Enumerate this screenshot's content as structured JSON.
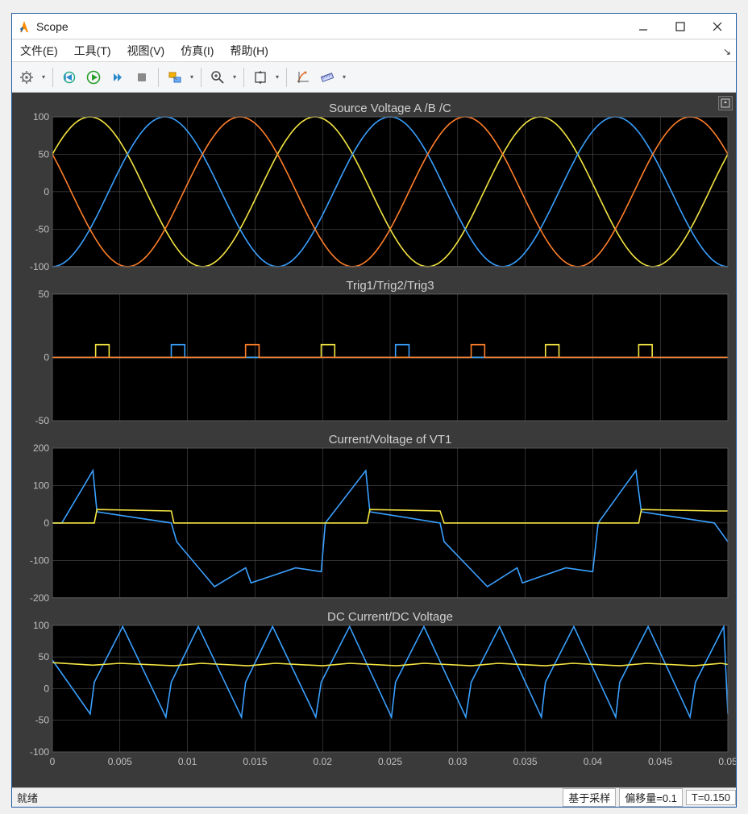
{
  "window": {
    "title": "Scope"
  },
  "menubar": {
    "file": "文件(E)",
    "tools": "工具(T)",
    "view": "视图(V)",
    "simulation": "仿真(I)",
    "help": "帮助(H)"
  },
  "toolbar": {
    "config": "config",
    "step_back": "step-back",
    "run": "run",
    "step_fwd": "step-forward",
    "stop": "stop",
    "highlight": "highlight",
    "zoom": "zoom",
    "fit": "fit-to-view",
    "cursor": "cursor-measure",
    "ruler": "ruler"
  },
  "statusbar": {
    "ready": "就绪",
    "sampled": "基于采样",
    "offset": "偏移量=0.1",
    "time": "T=0.150"
  },
  "chart_data": [
    {
      "type": "line",
      "title": "Source Voltage A /B /C",
      "xlim": [
        0,
        0.05
      ],
      "ylim": [
        -100,
        100
      ],
      "yticks": [
        -100,
        -50,
        0,
        50,
        100
      ],
      "xticks": [
        0,
        0.005,
        0.01,
        0.015,
        0.02,
        0.025,
        0.03,
        0.035,
        0.04,
        0.045,
        0.05
      ],
      "series": [
        {
          "name": "A",
          "color": "#f5e542",
          "formula": "100*sin(2*pi*60*t + 0.5236)"
        },
        {
          "name": "B",
          "color": "#3aa0ff",
          "formula": "100*sin(2*pi*60*t + 0.5236 - 2.0944)"
        },
        {
          "name": "C",
          "color": "#ff7f2a",
          "formula": "100*sin(2*pi*60*t + 0.5236 + 2.0944)"
        }
      ]
    },
    {
      "type": "line",
      "title": "Trig1/Trig2/Trig3",
      "xlim": [
        0,
        0.05
      ],
      "ylim": [
        -50,
        50
      ],
      "yticks": [
        -50,
        0,
        50
      ],
      "xticks": [
        0,
        0.005,
        0.01,
        0.015,
        0.02,
        0.025,
        0.03,
        0.035,
        0.04,
        0.045,
        0.05
      ],
      "series": [
        {
          "name": "Trig1",
          "color": "#f5e542",
          "pulses_at": [
            0.0032,
            0.0199,
            0.0365,
            0.0434
          ],
          "amplitude": 10,
          "width": 0.001
        },
        {
          "name": "Trig2",
          "color": "#3aa0ff",
          "pulses_at": [
            0.0088,
            0.0254
          ],
          "amplitude": 10,
          "width": 0.001
        },
        {
          "name": "Trig3",
          "color": "#ff7f2a",
          "pulses_at": [
            0.0143,
            0.031
          ],
          "amplitude": 10,
          "width": 0.001
        }
      ]
    },
    {
      "type": "line",
      "title": "Current/Voltage of VT1",
      "xlim": [
        0,
        0.05
      ],
      "ylim": [
        -200,
        200
      ],
      "yticks": [
        -200,
        -100,
        0,
        100,
        200
      ],
      "xticks": [
        0,
        0.005,
        0.01,
        0.015,
        0.02,
        0.025,
        0.03,
        0.035,
        0.04,
        0.045,
        0.05
      ],
      "series": [
        {
          "name": "Voltage",
          "color": "#3aa0ff",
          "breakpoints": [
            [
              0,
              0
            ],
            [
              0.0007,
              0
            ],
            [
              0.003,
              140
            ],
            [
              0.0033,
              30
            ],
            [
              0.0088,
              0
            ],
            [
              0.0092,
              -50
            ],
            [
              0.012,
              -170
            ],
            [
              0.0143,
              -120
            ],
            [
              0.0147,
              -160
            ],
            [
              0.018,
              -120
            ],
            [
              0.0199,
              -130
            ],
            [
              0.0202,
              0
            ],
            [
              0.0232,
              140
            ],
            [
              0.0235,
              30
            ],
            [
              0.0287,
              0
            ],
            [
              0.029,
              -50
            ],
            [
              0.0322,
              -170
            ],
            [
              0.0344,
              -120
            ],
            [
              0.0348,
              -160
            ],
            [
              0.038,
              -120
            ],
            [
              0.04,
              -130
            ],
            [
              0.0404,
              0
            ],
            [
              0.0432,
              140
            ],
            [
              0.0436,
              30
            ],
            [
              0.049,
              0
            ],
            [
              0.05,
              -50
            ]
          ]
        },
        {
          "name": "Current",
          "color": "#f5e542",
          "breakpoints": [
            [
              0,
              0
            ],
            [
              0.0007,
              0
            ],
            [
              0.0031,
              0
            ],
            [
              0.0033,
              36
            ],
            [
              0.0088,
              32
            ],
            [
              0.009,
              0
            ],
            [
              0.0233,
              0
            ],
            [
              0.0235,
              36
            ],
            [
              0.0287,
              32
            ],
            [
              0.029,
              0
            ],
            [
              0.0434,
              0
            ],
            [
              0.0436,
              36
            ],
            [
              0.049,
              32
            ],
            [
              0.05,
              32
            ]
          ]
        }
      ]
    },
    {
      "type": "line",
      "title": "DC Current/DC Voltage",
      "xlim": [
        0,
        0.05
      ],
      "ylim": [
        -100,
        100
      ],
      "yticks": [
        -100,
        -50,
        0,
        50,
        100
      ],
      "xticks": [
        0,
        0.005,
        0.01,
        0.015,
        0.02,
        0.025,
        0.03,
        0.035,
        0.04,
        0.045,
        0.05
      ],
      "series": [
        {
          "name": "DC Voltage",
          "color": "#3aa0ff",
          "breakpoints": [
            [
              0,
              45
            ],
            [
              0.0028,
              -40
            ],
            [
              0.0031,
              10
            ],
            [
              0.0052,
              98
            ],
            [
              0.0084,
              -45
            ],
            [
              0.0088,
              10
            ],
            [
              0.0108,
              98
            ],
            [
              0.014,
              -45
            ],
            [
              0.0143,
              10
            ],
            [
              0.0163,
              98
            ],
            [
              0.0195,
              -45
            ],
            [
              0.0199,
              10
            ],
            [
              0.022,
              98
            ],
            [
              0.0251,
              -45
            ],
            [
              0.0254,
              10
            ],
            [
              0.0275,
              98
            ],
            [
              0.0306,
              -45
            ],
            [
              0.031,
              10
            ],
            [
              0.0331,
              98
            ],
            [
              0.0362,
              -45
            ],
            [
              0.0365,
              10
            ],
            [
              0.0386,
              98
            ],
            [
              0.0417,
              -45
            ],
            [
              0.042,
              10
            ],
            [
              0.0441,
              98
            ],
            [
              0.0472,
              -45
            ],
            [
              0.0476,
              10
            ],
            [
              0.0497,
              98
            ],
            [
              0.05,
              -40
            ]
          ]
        },
        {
          "name": "DC Current",
          "color": "#f5e542",
          "breakpoints": [
            [
              0,
              41
            ],
            [
              0.003,
              37
            ],
            [
              0.005,
              40
            ],
            [
              0.009,
              36
            ],
            [
              0.011,
              40
            ],
            [
              0.0145,
              36
            ],
            [
              0.0165,
              40
            ],
            [
              0.02,
              36
            ],
            [
              0.022,
              40
            ],
            [
              0.0255,
              36
            ],
            [
              0.0275,
              40
            ],
            [
              0.031,
              36
            ],
            [
              0.033,
              40
            ],
            [
              0.0365,
              36
            ],
            [
              0.0385,
              40
            ],
            [
              0.042,
              36
            ],
            [
              0.044,
              40
            ],
            [
              0.0475,
              36
            ],
            [
              0.0495,
              40
            ],
            [
              0.05,
              38
            ]
          ]
        }
      ]
    }
  ],
  "xaxis_labels": [
    "0",
    "0.005",
    "0.01",
    "0.015",
    "0.02",
    "0.025",
    "0.03",
    "0.035",
    "0.04",
    "0.045",
    "0.05"
  ]
}
